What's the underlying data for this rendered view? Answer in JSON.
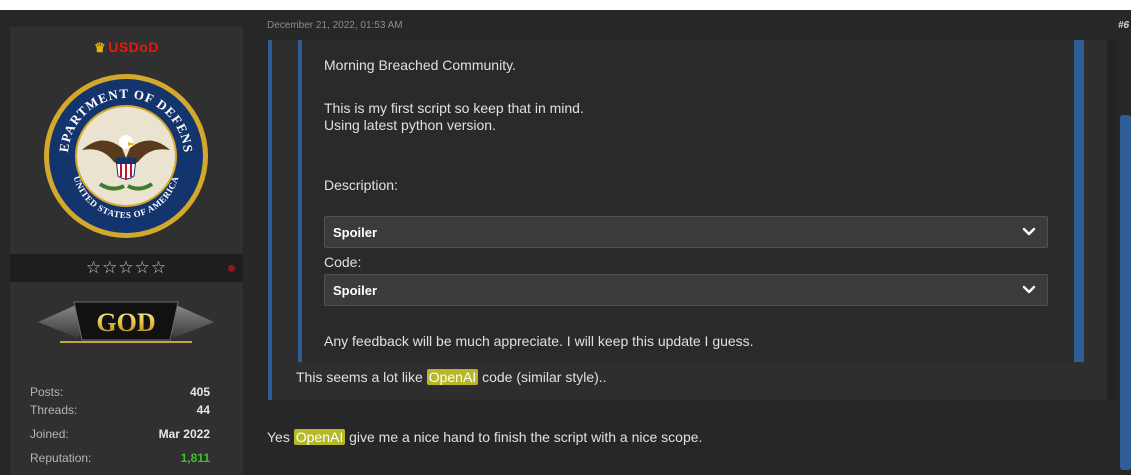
{
  "user": {
    "name": "USDoD",
    "rank": "GOD",
    "stars": "☆☆☆☆☆",
    "avatar_text_top": "DEPARTMENT OF DEFENSE",
    "avatar_text_bottom": "UNITED STATES OF AMERICA",
    "stats": [
      {
        "label": "Posts:",
        "value": "405"
      },
      {
        "label": "Threads:",
        "value": "44"
      },
      {
        "label": "Joined:",
        "value": "Mar 2022"
      },
      {
        "label": "Reputation:",
        "value": "1,811"
      }
    ]
  },
  "post": {
    "date": "December 21, 2022, 01:53 AM",
    "number": "#6",
    "quote": {
      "greeting": "Morning Breached Community.",
      "line1": "This is my first script so keep that in mind.",
      "line2": "Using latest python version.",
      "description_label": "Description:",
      "spoiler1_label": "Spoiler",
      "code_label": "Code:",
      "spoiler2_label": "Spoiler",
      "feedback": "Any feedback will be much appreciate. I will keep this update I guess."
    },
    "quote_reply": {
      "before": "This seems a lot like ",
      "mention": "OpenAI",
      "after": " code (similar style).."
    },
    "reply": {
      "before": "Yes ",
      "mention": "OpenAI",
      "after": " give me a nice hand to finish the script with a nice scope."
    }
  },
  "colors": {
    "accent_blue": "#2f5d97",
    "mention_bg": "#b7b72a",
    "username_red": "#e8190c",
    "reputation_green": "#41c02b"
  }
}
